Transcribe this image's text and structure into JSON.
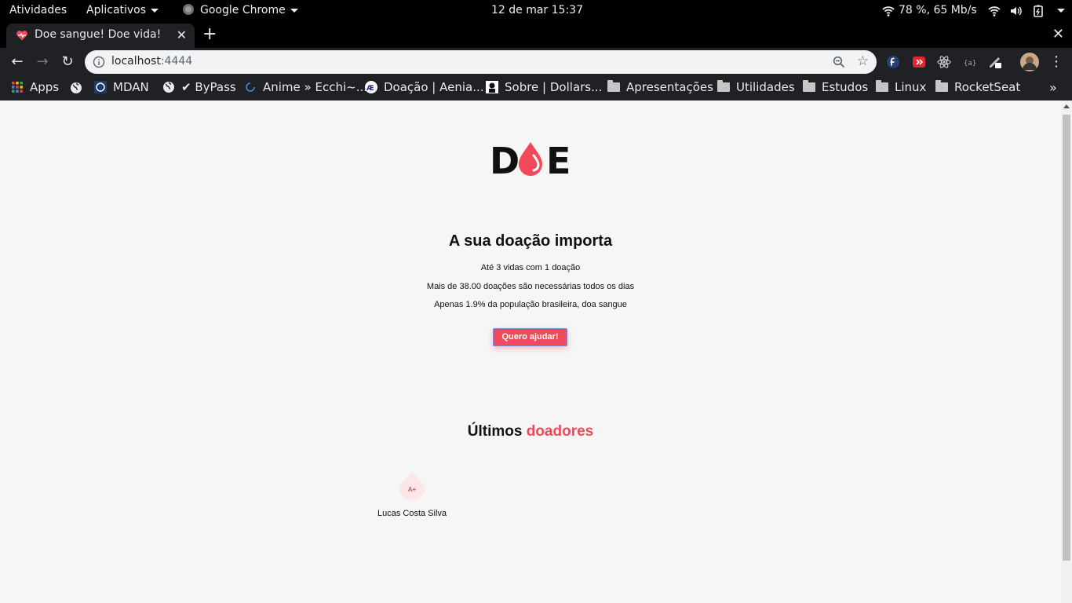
{
  "system_bar": {
    "activities": "Atividades",
    "applications": "Aplicativos",
    "focused_app": "Google Chrome",
    "datetime": "12 de mar  15:37",
    "network_status": "78 %, 65 Mb/s"
  },
  "browser": {
    "tab": {
      "title": "Doe sangue! Doe vida!"
    },
    "address": {
      "host": "localhost",
      "port": ":4444"
    },
    "bookmarks": [
      {
        "label": "Apps"
      },
      {
        "label": "MDAN"
      },
      {
        "label": "✔ ByPass"
      },
      {
        "label": "Anime » Ecchi~..."
      },
      {
        "label": "Doação | Aenia..."
      },
      {
        "label": "Sobre | Dollars..."
      },
      {
        "label": "Apresentações"
      },
      {
        "label": "Utilidades"
      },
      {
        "label": "Estudos"
      },
      {
        "label": "Linux"
      },
      {
        "label": "RocketSeat"
      }
    ]
  },
  "page": {
    "logo": {
      "left": "D",
      "right": "E"
    },
    "headline": "A sua doação importa",
    "facts": [
      "Até 3 vidas com 1 doação",
      "Mais de 38.00 doações são necessárias todos os dias",
      "Apenas 1.9% da população brasileira, doa sangue"
    ],
    "cta_label": "Quero ajudar!",
    "donors_section": {
      "title_start": "Últimos",
      "title_accent": "doadores"
    },
    "donors": [
      {
        "blood_type": "A+",
        "name": "Lucas Costa Silva"
      }
    ],
    "colors": {
      "accent": "#f1495a",
      "background": "#f6f6f6"
    }
  }
}
